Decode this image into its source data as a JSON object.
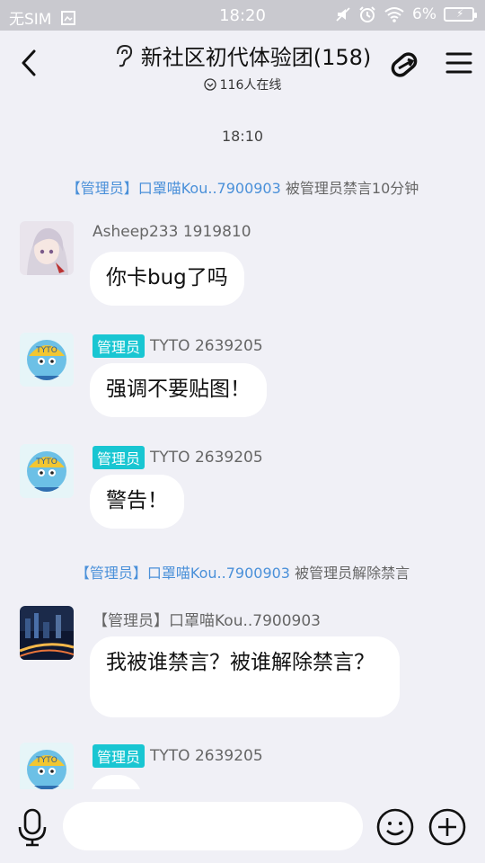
{
  "status_bar": {
    "carrier": "无SIM",
    "time": "18:20",
    "battery": "6%"
  },
  "header": {
    "title": "新社区初代体验团(158)",
    "online": "116人在线"
  },
  "chat": {
    "timestamp": "18:10",
    "system_1": {
      "role": "【管理员】",
      "user": "口罩喵Kou..7900903",
      "action": "被管理员禁言10分钟"
    },
    "system_2": {
      "role": "【管理员】",
      "user": "口罩喵Kou..7900903",
      "action": "被管理员解除禁言"
    },
    "messages": [
      {
        "badge": "",
        "name": "Asheep233 1919810",
        "text": "你卡bug了吗"
      },
      {
        "badge": "管理员",
        "name": "TYTO  2639205",
        "text": "强调不要贴图！"
      },
      {
        "badge": "管理员",
        "name": "TYTO  2639205",
        "text": "警告！"
      },
      {
        "badge": "",
        "name": "【管理员】口罩喵Kou..7900903",
        "text": "我被谁禁言？被谁解除禁言？"
      },
      {
        "badge": "管理员",
        "name": "TYTO  2639205",
        "text": ""
      }
    ]
  },
  "input": {
    "placeholder": ""
  },
  "colors": {
    "accent": "#19c6d2",
    "link": "#4a90d9",
    "background": "#f0f0f6"
  }
}
